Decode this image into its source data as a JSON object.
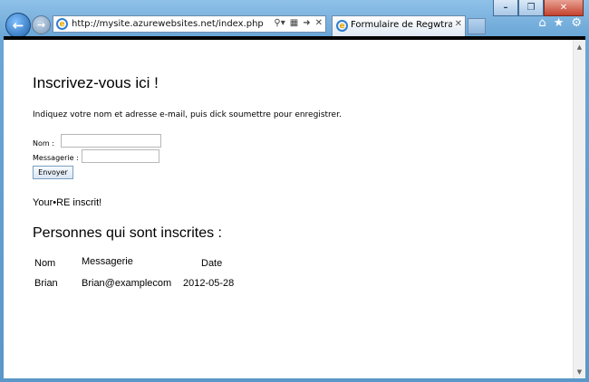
{
  "browser": {
    "url": "http://mysite.azurewebsites.net/index.php",
    "tab_title": "Formulaire de Regwtration",
    "window_buttons": [
      "–",
      "❐",
      "✕"
    ]
  },
  "page": {
    "heading": "Inscrivez-vous ici !",
    "intro": "Indiquez votre nom et adresse e-mail, puis dick soumettre pour enregistrer.",
    "name_label": "Nom :",
    "name_value": "",
    "email_label": "Messagerie :",
    "email_value": "",
    "submit_label": "Envoyer",
    "success_message": "Your•RE inscrit!",
    "list_heading": "Personnes qui sont inscrites :",
    "table": {
      "headers": [
        "Nom",
        "Messagerie",
        "Date"
      ],
      "rows": [
        [
          "Brian",
          "Brian@examplecom",
          "2012-05-28"
        ]
      ]
    }
  }
}
